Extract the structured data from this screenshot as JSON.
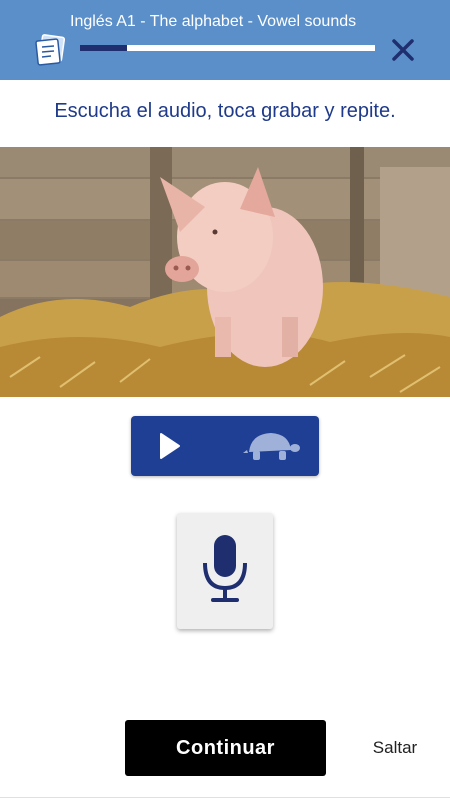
{
  "header": {
    "title": "Inglés A1 - The alphabet - Vowel sounds",
    "progress": 0.16,
    "close_icon": "close-icon",
    "lesson_icon": "notes-icon"
  },
  "exercise": {
    "instruction": "Escucha el audio, toca grabar y repite.",
    "image": "pig-in-straw-photo"
  },
  "audio_controls": {
    "play_icon": "play-icon",
    "slow_icon": "turtle-icon"
  },
  "record": {
    "mic_icon": "microphone-icon"
  },
  "footer": {
    "continue_label": "Continuar",
    "skip_label": "Saltar"
  },
  "colors": {
    "header_bg": "#5a8fc9",
    "accent_dark": "#1f2e6e",
    "button_blue": "#1f3f95",
    "instruction_text": "#1f3a8a"
  }
}
